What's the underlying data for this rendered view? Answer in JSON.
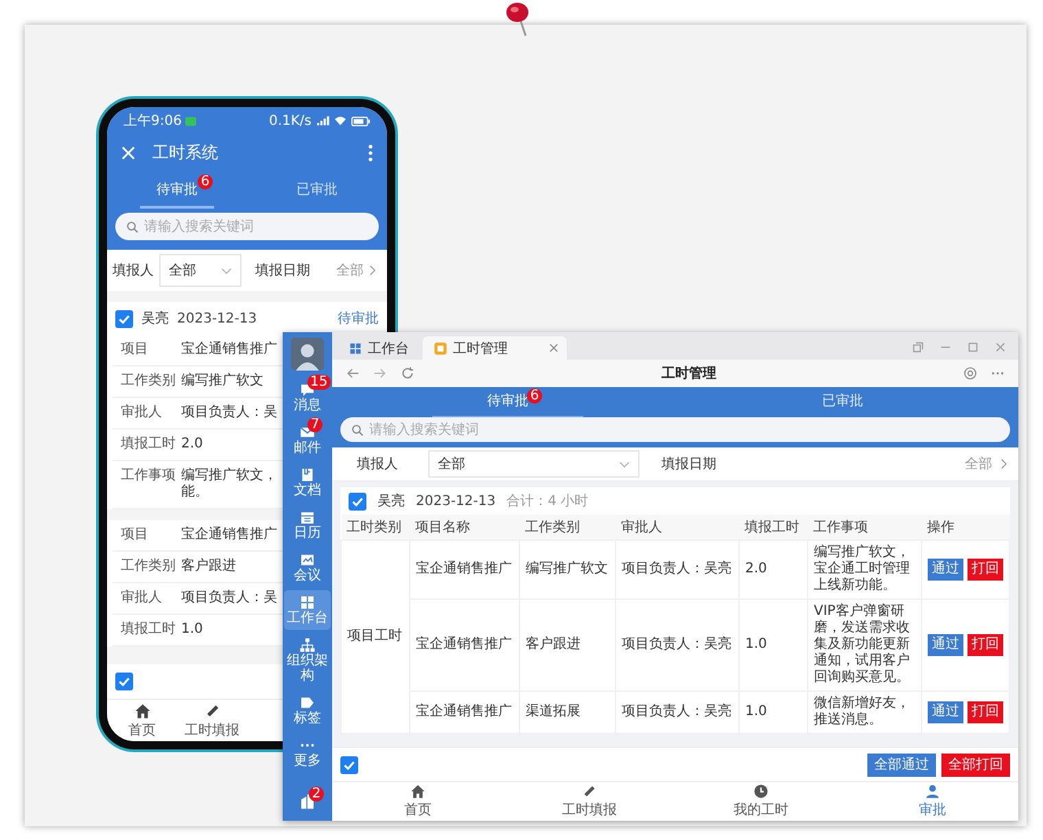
{
  "phone": {
    "status_bar": {
      "time": "上午9:06",
      "speed": "0.1K/s"
    },
    "title": "工时系统",
    "tabs": [
      {
        "label": "待审批",
        "badge": "6",
        "selected": true
      },
      {
        "label": "已审批",
        "selected": false
      }
    ],
    "search": {
      "placeholder": "请输入搜索关键词"
    },
    "filters": {
      "reporter_label": "填报人",
      "reporter_value": "全部",
      "date_label": "填报日期",
      "date_value": "全部"
    },
    "cards": [
      {
        "checked": true,
        "name": "吴亮",
        "date": "2023-12-13",
        "status": "待审批",
        "rows": [
          {
            "label": "项目",
            "lines": [
              "宝企通销售推广"
            ]
          },
          {
            "label": "工作类别",
            "lines": [
              "编写推广软文"
            ]
          },
          {
            "label": "审批人",
            "lines": [
              "项目负责人：吴"
            ]
          },
          {
            "label": "填报工时",
            "lines": [
              "2.0"
            ]
          },
          {
            "label": "工作事项",
            "lines": [
              "编写推广软文，",
              "能。"
            ]
          }
        ]
      },
      {
        "rows": [
          {
            "label": "项目",
            "lines": [
              "宝企通销售推广"
            ]
          },
          {
            "label": "工作类别",
            "lines": [
              "客户跟进"
            ]
          },
          {
            "label": "审批人",
            "lines": [
              "项目负责人：吴"
            ]
          },
          {
            "label": "填报工时",
            "lines": [
              "1.0"
            ]
          }
        ]
      }
    ],
    "select_all": {
      "checked": true
    },
    "nav": [
      {
        "label": "首页",
        "kind": "home"
      },
      {
        "label": "工时填报",
        "kind": "pencil"
      }
    ]
  },
  "desktop": {
    "sidebar": {
      "items": [
        {
          "label": "消息",
          "kind": "chat",
          "badge": "15",
          "selected": false
        },
        {
          "label": "邮件",
          "kind": "mail",
          "badge": "7",
          "selected": false
        },
        {
          "label": "文档",
          "kind": "doc",
          "selected": false
        },
        {
          "label": "日历",
          "kind": "calendar",
          "selected": false
        },
        {
          "label": "会议",
          "kind": "meeting",
          "selected": false
        },
        {
          "label": "工作台",
          "kind": "grid",
          "selected": true
        },
        {
          "label": "组织架构",
          "kind": "org",
          "selected": false
        },
        {
          "label": "标签",
          "kind": "tag",
          "selected": false
        },
        {
          "label": "更多",
          "kind": "more",
          "selected": false
        }
      ],
      "bottom_badge": "2"
    },
    "browser_tabs": [
      {
        "label": "工作台",
        "kind": "grid",
        "selected": false,
        "closable": false
      },
      {
        "label": "工时管理",
        "kind": "app",
        "selected": true,
        "closable": true
      }
    ],
    "page_title": "工时管理",
    "tabs": [
      {
        "label": "待审批",
        "badge": "6",
        "selected": true
      },
      {
        "label": "已审批",
        "selected": false
      }
    ],
    "search": {
      "placeholder": "请输入搜索关键词"
    },
    "filters": {
      "reporter_label": "填报人",
      "reporter_value": "全部",
      "date_label": "填报日期",
      "date_value": "全部"
    },
    "card": {
      "checked": true,
      "name": "吴亮",
      "date": "2023-12-13",
      "total": "合计：4 小时"
    },
    "table": {
      "columns": [
        "工时类别",
        "项目名称",
        "工作类别",
        "审批人",
        "填报工时",
        "工作事项",
        "操作"
      ],
      "group": "项目工时",
      "rows": [
        {
          "project": "宝企通销售推广",
          "type": "编写推广软文",
          "approver": "项目负责人：吴亮",
          "hours": "2.0",
          "note": "编写推广软文，宝企通工时管理上线新功能。",
          "actions": [
            {
              "label": "通过",
              "kind": "approve"
            },
            {
              "label": "打回",
              "kind": "reject"
            }
          ]
        },
        {
          "project": "宝企通销售推广",
          "type": "客户跟进",
          "approver": "项目负责人：吴亮",
          "hours": "1.0",
          "note": "VIP客户弹窗研磨，发送需求收集及新功能更新通知，试用客户回询购买意见。",
          "actions": [
            {
              "label": "通过",
              "kind": "approve"
            },
            {
              "label": "打回",
              "kind": "reject"
            }
          ]
        },
        {
          "project": "宝企通销售推广",
          "type": "渠道拓展",
          "approver": "项目负责人：吴亮",
          "hours": "1.0",
          "note": "微信新增好友，推送消息。",
          "actions": [
            {
              "label": "通过",
              "kind": "approve"
            },
            {
              "label": "打回",
              "kind": "reject"
            }
          ]
        }
      ]
    },
    "footer": {
      "checked": true,
      "buttons": [
        {
          "label": "全部通过",
          "kind": "approve"
        },
        {
          "label": "全部打回",
          "kind": "reject"
        }
      ]
    },
    "nav": [
      {
        "label": "首页",
        "kind": "home",
        "selected": false
      },
      {
        "label": "工时填报",
        "kind": "pencil",
        "selected": false
      },
      {
        "label": "我的工时",
        "kind": "clock",
        "selected": false
      },
      {
        "label": "审批",
        "kind": "person",
        "selected": true
      }
    ]
  }
}
